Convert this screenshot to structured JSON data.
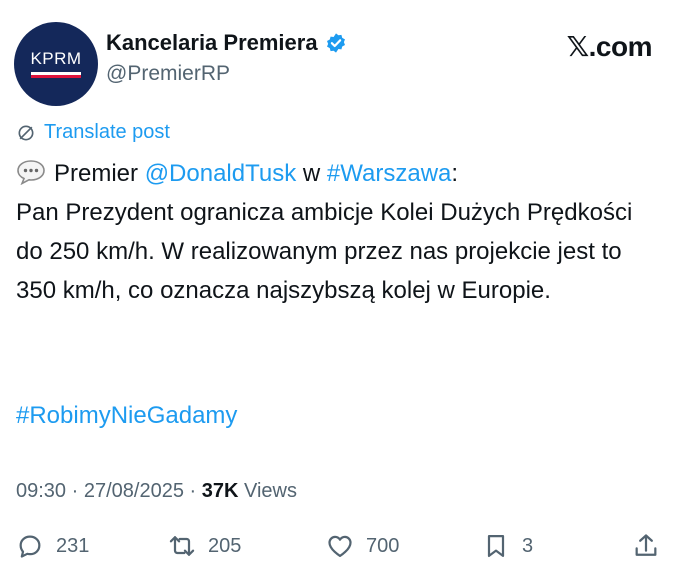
{
  "avatar": {
    "text": "KPRM"
  },
  "author": {
    "name": "Kancelaria Premiera",
    "handle": "@PremierRP"
  },
  "site": "𝕏.com",
  "translate_label": "Translate post",
  "tweet": {
    "emoji": "speech-balloon-icon",
    "prefix": "Premier ",
    "mention": "@DonaldTusk",
    "middle": " w ",
    "place_tag": "#Warszawa",
    "colon": ":",
    "body": "Pan Prezydent ogranicza ambicje Kolei Dużych Prędkości do 250 km/h. W realizowanym przez nas projekcie jest to 350 km/h, co oznacza najszybszą kolej w Europie.",
    "hashtag": "#RobimyNieGadamy"
  },
  "meta": {
    "time": "09:30",
    "date": "27/08/2025",
    "views_count": "37K",
    "views_label": "Views",
    "sep": " · "
  },
  "actions": {
    "replies": "231",
    "reposts": "205",
    "likes": "700",
    "bookmarks": "3"
  },
  "colors": {
    "link": "#1d9bf0",
    "muted": "#536471",
    "text": "#0f1419",
    "avatar_bg": "#14285a"
  }
}
